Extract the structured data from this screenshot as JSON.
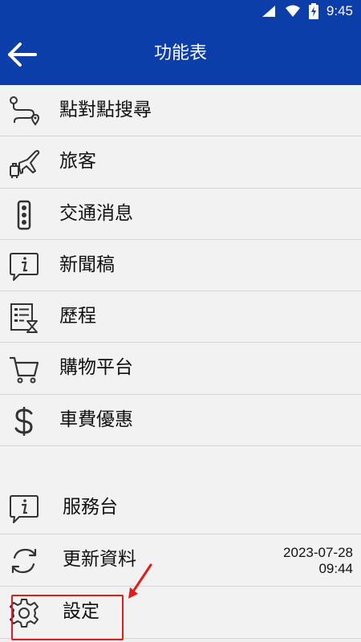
{
  "status_bar": {
    "time": "9:45",
    "icons": [
      "signal-icon",
      "wifi-icon",
      "battery-charging-icon"
    ]
  },
  "app_bar": {
    "title": "功能表",
    "back_icon": "arrow-left-icon"
  },
  "menu": {
    "items": [
      {
        "label": "點對點搜尋",
        "icon": "route-search-icon"
      },
      {
        "label": "旅客",
        "icon": "traveler-airplane-icon"
      },
      {
        "label": "交通消息",
        "icon": "traffic-light-icon"
      },
      {
        "label": "新聞稿",
        "icon": "info-chat-icon"
      },
      {
        "label": "歷程",
        "icon": "history-list-icon"
      },
      {
        "label": "購物平台",
        "icon": "shopping-cart-icon"
      },
      {
        "label": "車費優惠",
        "icon": "dollar-icon"
      }
    ]
  },
  "menu2": {
    "items": [
      {
        "label": "服務台",
        "icon": "info-chat-icon"
      },
      {
        "label": "更新資料",
        "icon": "refresh-icon"
      },
      {
        "label": "設定",
        "icon": "gear-icon"
      }
    ],
    "update_date": "2023-07-28",
    "update_time": "09:44"
  },
  "colors": {
    "header": "#0b3ea8",
    "background": "#f2f2f2",
    "divider": "#d6d6d6",
    "highlight": "#e01d1d"
  }
}
